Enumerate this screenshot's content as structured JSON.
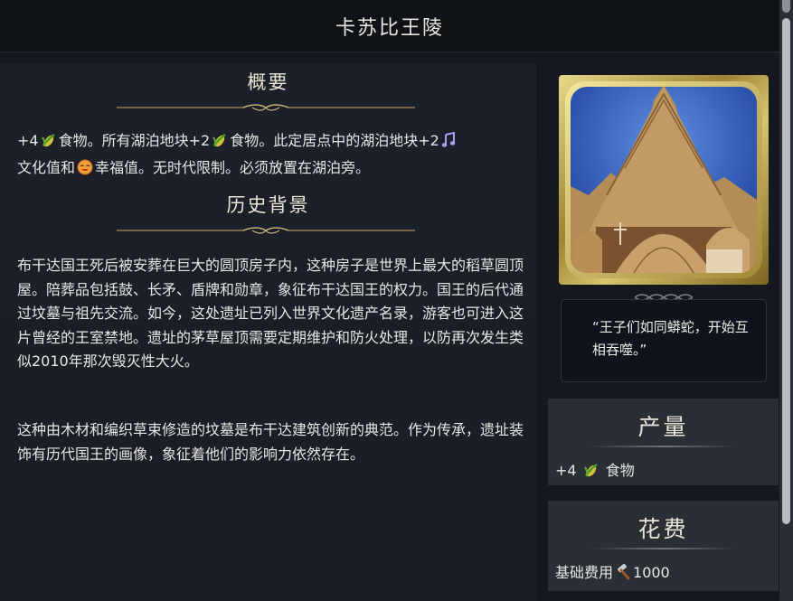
{
  "window": {
    "title": "卡苏比王陵"
  },
  "overview": {
    "heading": "概要",
    "text_a": "+4",
    "text_b": "食物。所有湖泊地块+2",
    "text_c": "食物。此定居点中的湖泊地块+2",
    "text_d": "文化值和",
    "text_e": "幸福值。无时代限制。必须放置在湖泊旁。"
  },
  "history": {
    "heading": "历史背景",
    "paragraph1": "布干达国王死后被安葬在巨大的圆顶房子内，这种房子是世界上最大的稻草圆顶屋。陪葬品包括鼓、长矛、盾牌和勋章，象征布干达国王的权力。国王的后代通过坟墓与祖先交流。如今，这处遗址已列入世界文化遗产名录，游客也可进入这片曾经的王室禁地。遗址的茅草屋顶需要定期维护和防火处理，以防再次发生类似2010年那次毁灭性大火。",
    "paragraph2": "这种由木材和编织草束修造的坟墓是布干达建筑创新的典范。作为传承，遗址装饰有历代国王的画像，象征着他们的影响力依然存在。"
  },
  "quote": {
    "text": "“王子们如同蟒蛇，开始互相吞噬。”"
  },
  "production": {
    "heading": "产量",
    "amount": "+4",
    "resource": "食物",
    "resource_icon": "food-icon"
  },
  "cost": {
    "heading": "花费",
    "label": "基础费用",
    "value": "1000",
    "icon": "hammer-icon"
  },
  "colors": {
    "gold_frame": "#c9ad4f",
    "background": "#15191f",
    "panel": "#2a2f36",
    "text": "#e6e6e6"
  }
}
